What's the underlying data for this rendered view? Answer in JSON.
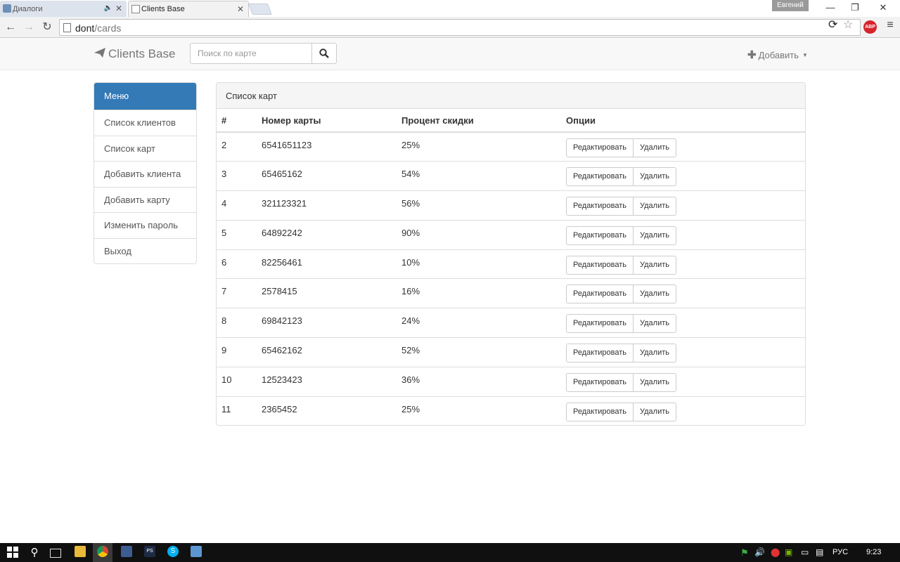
{
  "browser": {
    "tabs": [
      {
        "title": "Диалоги",
        "active": false
      },
      {
        "title": "Clients Base",
        "active": true
      }
    ],
    "profile_name": "Евгений",
    "url_host": "dont",
    "url_path": "/cards",
    "window_controls": {
      "minimize": "—",
      "maximize": "❐",
      "close": "✕"
    }
  },
  "navbar": {
    "brand": "Clients Base",
    "search_placeholder": "Поиск по карте",
    "add_label": "Добавить"
  },
  "menu": {
    "header": "Меню",
    "items": [
      "Список клиентов",
      "Список карт",
      "Добавить клиента",
      "Добавить карту",
      "Изменить пароль",
      "Выход"
    ]
  },
  "panel": {
    "title": "Список карт",
    "columns": [
      "#",
      "Номер карты",
      "Процент скидки",
      "Опции"
    ],
    "rows": [
      {
        "id": "2",
        "card": "6541651123",
        "discount": "25%"
      },
      {
        "id": "3",
        "card": "65465162",
        "discount": "54%"
      },
      {
        "id": "4",
        "card": "321123321",
        "discount": "56%"
      },
      {
        "id": "5",
        "card": "64892242",
        "discount": "90%"
      },
      {
        "id": "6",
        "card": "82256461",
        "discount": "10%"
      },
      {
        "id": "7",
        "card": "2578415",
        "discount": "16%"
      },
      {
        "id": "8",
        "card": "69842123",
        "discount": "24%"
      },
      {
        "id": "9",
        "card": "65462162",
        "discount": "52%"
      },
      {
        "id": "10",
        "card": "12523423",
        "discount": "36%"
      },
      {
        "id": "11",
        "card": "2365452",
        "discount": "25%"
      }
    ],
    "edit_label": "Редактировать",
    "delete_label": "Удалить"
  },
  "taskbar": {
    "ps_label": "PS",
    "skype_label": "S",
    "language": "РУС",
    "clock": "9:23"
  },
  "colors": {
    "primary": "#337ab7",
    "navbar_bg": "#f8f8f8",
    "border": "#dddddd",
    "abp_red": "#d6242b"
  }
}
